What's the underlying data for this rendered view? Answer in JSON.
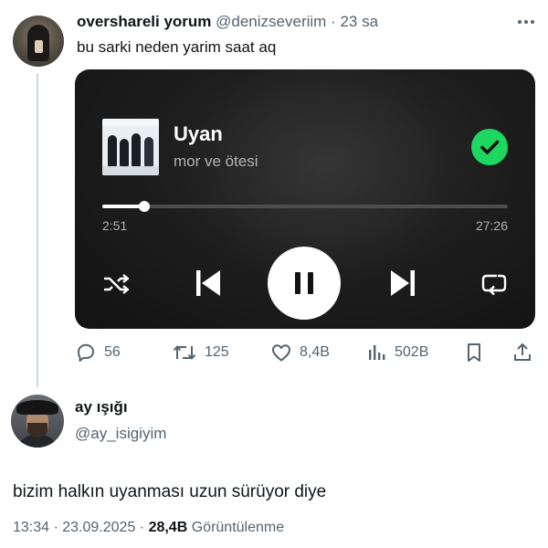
{
  "tweet1": {
    "display_name": "oversharelі yorum",
    "handle": "@denizseveriim",
    "separator": " · ",
    "time": "23 sa",
    "text": "bu sarki neden yarim saat aq",
    "more_icon": "more-horizontal-icon"
  },
  "player": {
    "title": "Uyan",
    "artist": "mor ve ötesi",
    "elapsed": "2:51",
    "duration": "27:26",
    "progress_fraction": 0.104,
    "accent_color": "#1ed760",
    "icons": [
      "shuffle-icon",
      "previous-icon",
      "pause-icon",
      "next-icon",
      "repeat-icon",
      "check-icon"
    ]
  },
  "actions": {
    "replies": "56",
    "retweets": "125",
    "likes": "8,4B",
    "views": "502B"
  },
  "tweet2": {
    "display_name": "ay ışığı",
    "handle": "@ay_isigiyim",
    "text": "bizim halkın uyanması uzun sürüyor diye",
    "time": "13:34",
    "date": "23.09.2025",
    "sep": " · ",
    "views_count": "28,4B",
    "views_label": "Görüntülenme"
  }
}
